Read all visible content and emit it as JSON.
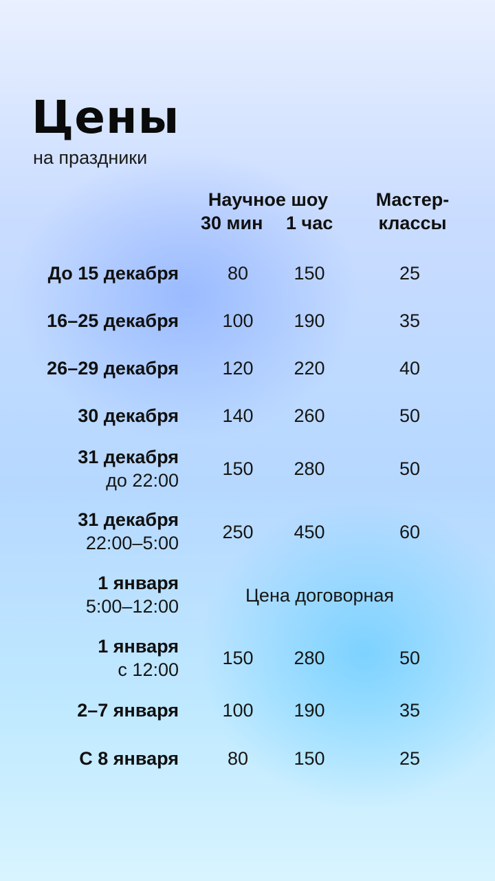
{
  "title": "Цены",
  "subtitle": "на праздники",
  "headers": {
    "show": "Научное шоу",
    "min30": "30 мин",
    "hour1": "1 час",
    "master_line1": "Мастер-",
    "master_line2": "классы"
  },
  "rows": [
    {
      "date": "До 15 декабря",
      "time": "",
      "show30": "80",
      "show60": "150",
      "master": "25"
    },
    {
      "date": "16–25 декабря",
      "time": "",
      "show30": "100",
      "show60": "190",
      "master": "35"
    },
    {
      "date": "26–29 декабря",
      "time": "",
      "show30": "120",
      "show60": "220",
      "master": "40"
    },
    {
      "date": "30 декабря",
      "time": "",
      "show30": "140",
      "show60": "260",
      "master": "50"
    },
    {
      "date": "31 декабря",
      "time": "до 22:00",
      "show30": "150",
      "show60": "280",
      "master": "50"
    },
    {
      "date": "31 декабря",
      "time": "22:00–5:00",
      "show30": "250",
      "show60": "450",
      "master": "60"
    },
    {
      "date": "1 января",
      "time": "5:00–12:00",
      "note": "Цена договорная"
    },
    {
      "date": "1 января",
      "time": "с 12:00",
      "show30": "150",
      "show60": "280",
      "master": "50"
    },
    {
      "date": "2–7 января",
      "time": "",
      "show30": "100",
      "show60": "190",
      "master": "35"
    },
    {
      "date": "С 8 января",
      "time": "",
      "show30": "80",
      "show60": "150",
      "master": "25"
    }
  ]
}
